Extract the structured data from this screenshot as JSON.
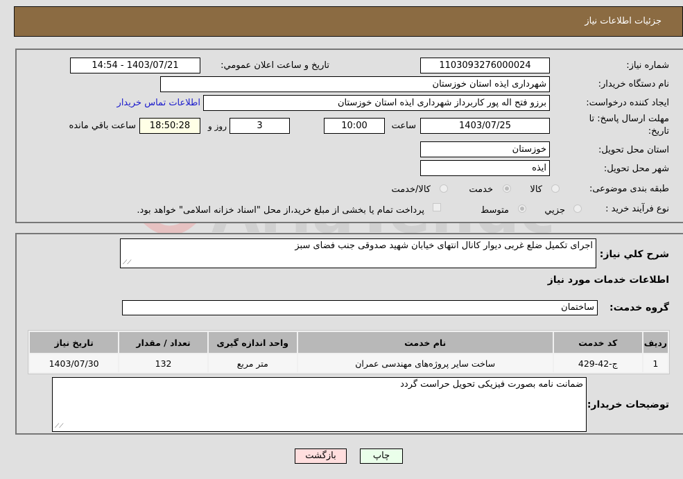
{
  "header": {
    "title": "جزئیات اطلاعات نیاز"
  },
  "form": {
    "need_number": {
      "label": "شماره نیاز:",
      "value": "1103093276000024"
    },
    "announce_datetime": {
      "label": "تاریخ و ساعت اعلان عمومي:",
      "value": "1403/07/21 - 14:54"
    },
    "buyer_org": {
      "label": "نام دستگاه خریدار:",
      "value": "شهرداری ایذه استان خوزستان"
    },
    "requester": {
      "label": "ایجاد کننده درخواست:",
      "value": "برزو فتح اله پور کاربرداز شهرداری ایذه استان خوزستان"
    },
    "buyer_contact_link": "اطلاعات تماس خریدار",
    "deadline": {
      "label_line1": "مهلت ارسال پاسخ: تا",
      "label_line2": "تاریخ:",
      "date": "1403/07/25",
      "time_label": "ساعت",
      "time": "10:00",
      "days": "3",
      "days_label": "روز و",
      "remaining": "18:50:28",
      "remaining_label": "ساعت باقي مانده"
    },
    "delivery_province": {
      "label": "استان محل تحویل:",
      "value": "خوزستان"
    },
    "delivery_city": {
      "label": "شهر محل تحویل:",
      "value": "ایذه"
    },
    "category": {
      "label": "طبقه بندی موضوعی:",
      "options": [
        "کالا",
        "خدمت",
        "کالا/خدمت"
      ],
      "selected": "خدمت"
    },
    "purchase_type": {
      "label": "نوع فرآیند خرید :",
      "options": [
        "جزیي",
        "متوسط"
      ],
      "selected": "متوسط",
      "treasury_note": "پرداخت تمام یا بخشی از مبلغ خرید،از محل \"اسناد خزانه اسلامی\" خواهد بود.",
      "treasury_checked": false
    }
  },
  "details": {
    "description_label": "شرح کلي نیاز:",
    "description": "اجرای تکمیل  ضلع غربی دیوار کانال انتهای خیابان شهید صدوقی جنب فضای سبز",
    "services_heading": "اطلاعات خدمات مورد نیاز",
    "service_group_label": "گروه خدمت:",
    "service_group": "ساختمان",
    "table": {
      "headers": [
        "ردیف",
        "کد خدمت",
        "نام خدمت",
        "واحد اندازه گیری",
        "تعداد / مقدار",
        "تاریخ نیاز"
      ],
      "rows": [
        [
          "1",
          "ج-42-429",
          "ساخت سایر پروژه‌های مهندسی عمران",
          "متر مربع",
          "132",
          "1403/07/30"
        ]
      ]
    },
    "buyer_notes_label": "توضیحات خریدار:",
    "buyer_notes": "ضمانت نامه بصورت فیزیکی تحویل حراست گردد"
  },
  "buttons": {
    "print": "چاپ",
    "back": "بازگشت"
  },
  "colors": {
    "header_bg": "#8b6b42",
    "print_bg": "#eaffea",
    "back_bg": "#ffdede",
    "remaining_bg": "#ffffe6",
    "link": "#1a1acc"
  }
}
